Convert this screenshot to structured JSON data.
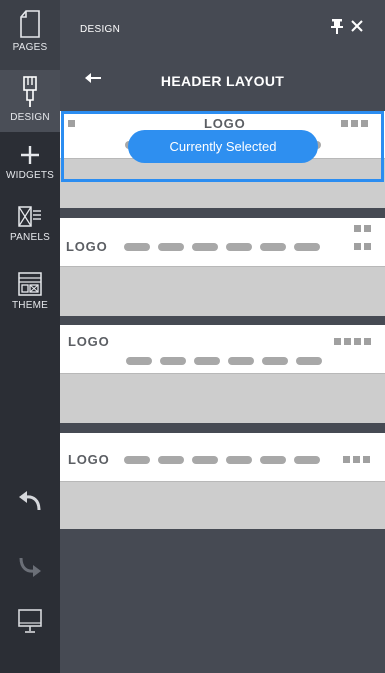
{
  "rail": {
    "pages": "PAGES",
    "design": "DESIGN",
    "widgets": "WIDGETS",
    "panels": "PANELS",
    "theme": "THEME"
  },
  "panel": {
    "title": "DESIGN",
    "subtitle": "HEADER LAYOUT"
  },
  "layouts": [
    {
      "logo": "LOGO",
      "badge": "Currently Selected",
      "selected": true
    },
    {
      "logo": "LOGO"
    },
    {
      "logo": "LOGO"
    },
    {
      "logo": "LOGO"
    }
  ],
  "colors": {
    "accent": "#2e8ff0",
    "rail_bg": "#2b2e35",
    "panel_bg": "#464a53",
    "placeholder": "#cdcdcd"
  },
  "icons": [
    "page-icon",
    "brush-icon",
    "plus-icon",
    "panels-icon",
    "theme-icon",
    "undo-icon",
    "redo-icon",
    "desktop-icon",
    "pin-icon",
    "close-icon",
    "back-arrow-icon"
  ]
}
